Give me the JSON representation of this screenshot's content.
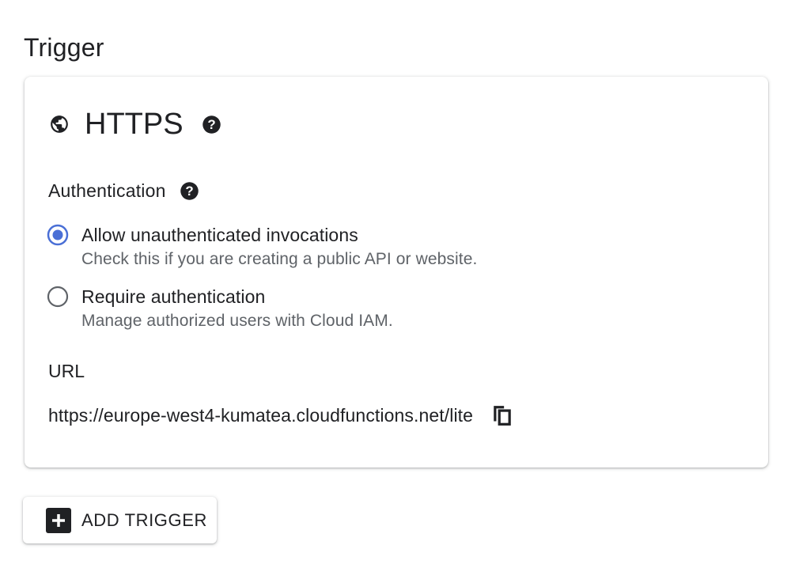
{
  "section": {
    "title": "Trigger"
  },
  "trigger_card": {
    "type_label": "HTTPS",
    "type_icon": "globe-icon",
    "help_icon": "help-icon",
    "authentication": {
      "label": "Authentication",
      "help_icon": "help-icon",
      "options": [
        {
          "title": "Allow unauthenticated invocations",
          "description": "Check this if you are creating a public API or website.",
          "selected": true
        },
        {
          "title": "Require authentication",
          "description": "Manage authorized users with Cloud IAM.",
          "selected": false
        }
      ]
    },
    "url": {
      "label": "URL",
      "value": "https://europe-west4-kumatea.cloudfunctions.net/lite",
      "copy_icon": "copy-icon"
    }
  },
  "add_trigger": {
    "label": "ADD TRIGGER",
    "icon": "add-box-icon"
  },
  "colors": {
    "accent": "#4a6fd6",
    "text_primary": "#202124",
    "text_secondary": "#5f6368",
    "radio_unselected": "#5f6368"
  }
}
